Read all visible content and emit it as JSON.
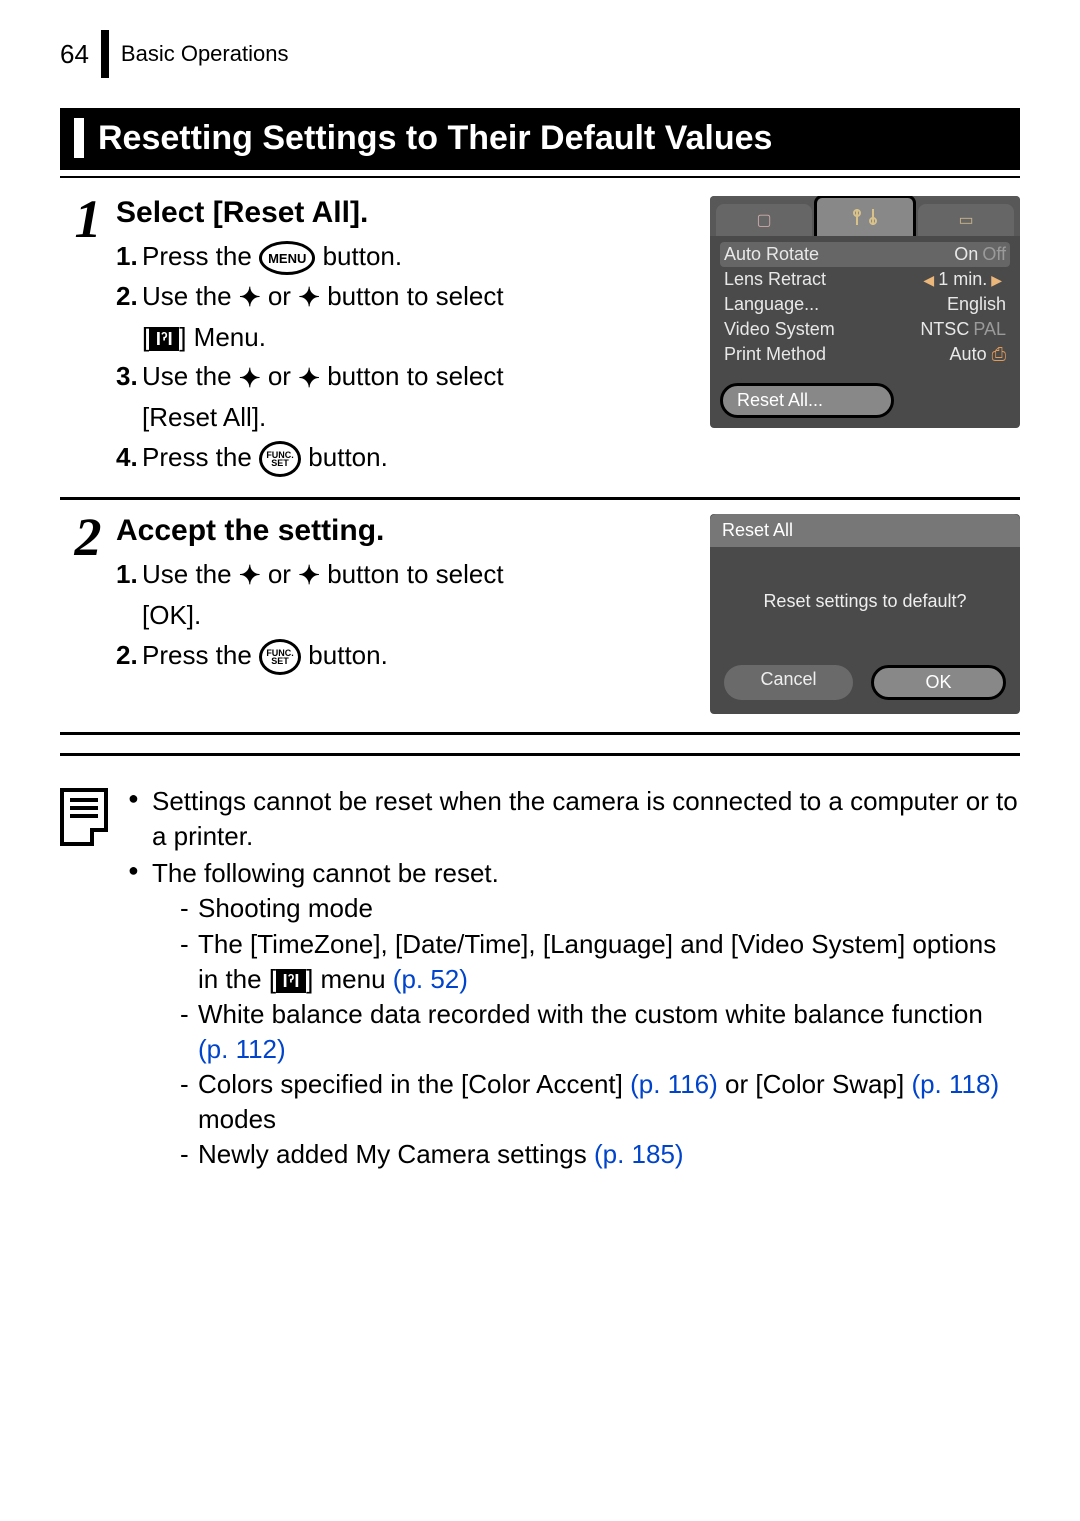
{
  "header": {
    "page_number": "64",
    "section": "Basic Operations"
  },
  "title": "Resetting Settings to Their Default Values",
  "step1": {
    "number": "1",
    "title": "Select [Reset All].",
    "s1a": "1.",
    "s1b": "Press the ",
    "s1c": " button.",
    "menu_btn": "MENU",
    "s2a": "2.",
    "s2b": "Use the ",
    "s2c": " or ",
    "s2d": " button to select",
    "s2e": "[",
    "s2f": "] Menu.",
    "s3a": "3.",
    "s3b": "Use the ",
    "s3c": " or ",
    "s3d": " button to select",
    "s3e": "[Reset All].",
    "s4a": "4.",
    "s4b": "Press the ",
    "s4c": " button.",
    "func_top": "FUNC.",
    "func_bot": "SET",
    "lcd": {
      "rows": [
        {
          "label": "Auto Rotate",
          "val_on": "On",
          "val_off": "Off"
        },
        {
          "label": "Lens Retract",
          "val": "1 min."
        },
        {
          "label": "Language...",
          "val": "English"
        },
        {
          "label": "Video System",
          "val_on": "NTSC",
          "val_off": "PAL"
        },
        {
          "label": "Print Method",
          "val": "Auto"
        }
      ],
      "reset": "Reset All..."
    }
  },
  "step2": {
    "number": "2",
    "title": "Accept the setting.",
    "s1a": "1.",
    "s1b": "Use the ",
    "s1c": " or ",
    "s1d": " button to select",
    "s1e": "[OK].",
    "s2a": "2.",
    "s2b": "Press the ",
    "s2c": " button.",
    "lcd": {
      "title": "Reset All",
      "msg": "Reset settings to default?",
      "cancel": "Cancel",
      "ok": "OK"
    }
  },
  "notes": {
    "b1": "Settings cannot be reset when the camera is connected to a computer or to a printer.",
    "b2": "The following cannot be reset.",
    "sub1": "Shooting mode",
    "sub2a": "The [TimeZone], [Date/Time], [Language] and [Video System] options in the [",
    "sub2b": "] menu ",
    "sub2ref": "(p. 52)",
    "sub3a": "White balance data recorded with the custom white balance function ",
    "sub3ref": "(p. 112)",
    "sub4a": "Colors specified in the [Color Accent] ",
    "sub4ref1": "(p. 116)",
    "sub4b": " or [Color Swap] ",
    "sub4ref2": "(p. 118)",
    "sub4c": " modes",
    "sub5a": "Newly added My Camera settings ",
    "sub5ref": "(p. 185)"
  },
  "icons": {
    "tools": "ӀˀӀ"
  }
}
